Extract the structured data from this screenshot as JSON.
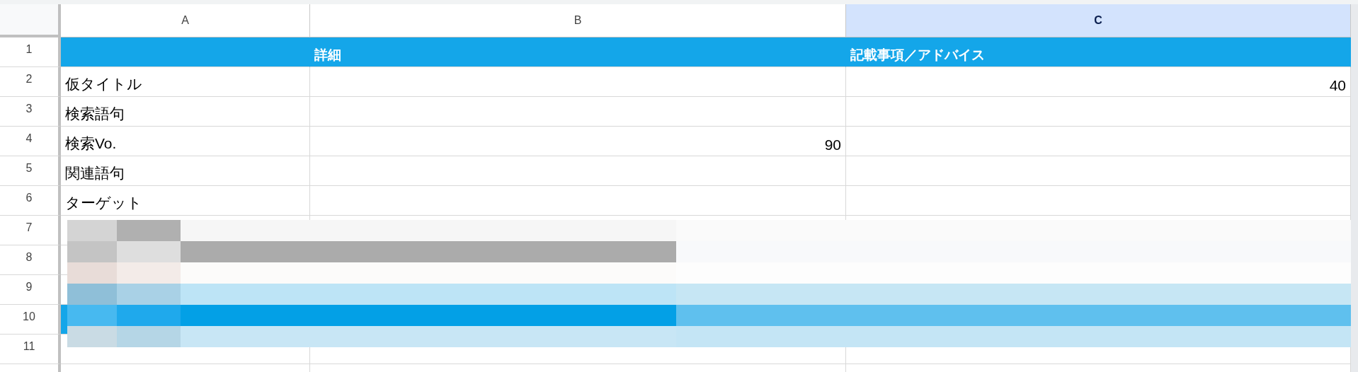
{
  "columns": [
    {
      "label": "A",
      "selected": false
    },
    {
      "label": "B",
      "selected": false
    },
    {
      "label": "C",
      "selected": true
    }
  ],
  "rows": [
    {
      "number": "1",
      "kind": "header",
      "b": "詳細",
      "c": "記載事項／アドバイス"
    },
    {
      "number": "2",
      "kind": "data",
      "a": "仮タイトル",
      "c": "40"
    },
    {
      "number": "3",
      "kind": "data",
      "a": "検索語句"
    },
    {
      "number": "4",
      "kind": "data",
      "a": "検索Vo.",
      "b": "90"
    },
    {
      "number": "5",
      "kind": "data",
      "a": "関連語句"
    },
    {
      "number": "6",
      "kind": "data",
      "a": "ターゲット"
    },
    {
      "number": "7",
      "kind": "data"
    },
    {
      "number": "8",
      "kind": "data"
    },
    {
      "number": "9",
      "kind": "data"
    },
    {
      "number": "10",
      "kind": "header"
    },
    {
      "number": "11",
      "kind": "data"
    }
  ]
}
